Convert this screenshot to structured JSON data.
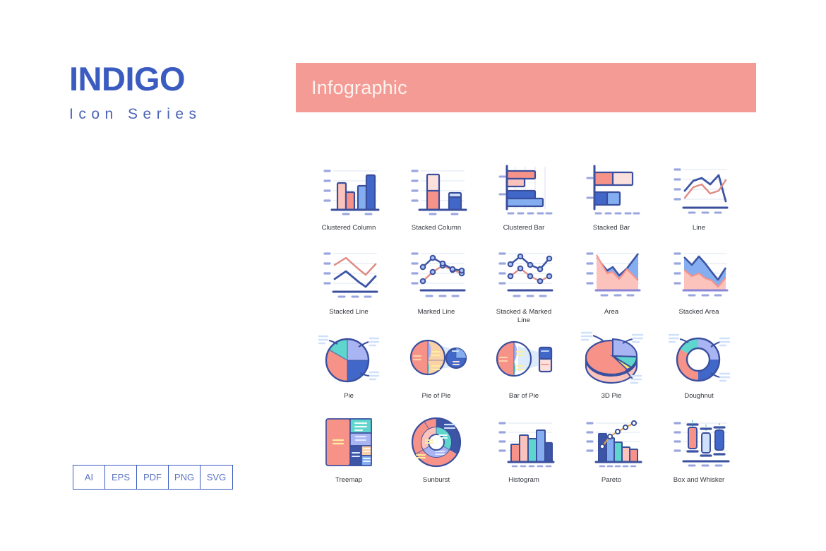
{
  "brand": {
    "title": "INDIGO",
    "subtitle": "Icon Series",
    "title_color": "#3a5bbf"
  },
  "formats": [
    {
      "label": "AI"
    },
    {
      "label": "EPS"
    },
    {
      "label": "PDF"
    },
    {
      "label": "PNG"
    },
    {
      "label": "SVG"
    }
  ],
  "banner": {
    "title": "Infographic",
    "background": "#f49b96",
    "text_color": "#fdf3ef"
  },
  "palette": {
    "navy": "#3d55a5",
    "blue": "#4168c8",
    "light_blue": "#84aef0",
    "lavender": "#a9b4f2",
    "salmon": "#f79289",
    "light_salmon": "#fbc3bc",
    "teal": "#5fd6cd",
    "peach": "#fbd1a8",
    "outline": "#3a4f9e",
    "grid": "#e8edf7",
    "tick": "#9aa6e0"
  },
  "grid": {
    "columns": 5,
    "icons": [
      {
        "name": "clustered-column",
        "label": "Clustered Column"
      },
      {
        "name": "stacked-column",
        "label": "Stacked Column"
      },
      {
        "name": "clustered-bar",
        "label": "Clustered Bar"
      },
      {
        "name": "stacked-bar",
        "label": "Stacked Bar"
      },
      {
        "name": "line",
        "label": "Line"
      },
      {
        "name": "stacked-line",
        "label": "Stacked Line"
      },
      {
        "name": "marked-line",
        "label": "Marked Line"
      },
      {
        "name": "stacked-marked-line",
        "label": "Stacked & Marked Line"
      },
      {
        "name": "area",
        "label": "Area"
      },
      {
        "name": "stacked-area",
        "label": "Stacked Area"
      },
      {
        "name": "pie",
        "label": "Pie"
      },
      {
        "name": "pie-of-pie",
        "label": "Pie of Pie"
      },
      {
        "name": "bar-of-pie",
        "label": "Bar of Pie"
      },
      {
        "name": "3d-pie",
        "label": "3D Pie"
      },
      {
        "name": "doughnut",
        "label": "Doughnut"
      },
      {
        "name": "treemap",
        "label": "Treemap"
      },
      {
        "name": "sunburst",
        "label": "Sunburst"
      },
      {
        "name": "histogram",
        "label": "Histogram"
      },
      {
        "name": "pareto",
        "label": "Pareto"
      },
      {
        "name": "box-and-whisker",
        "label": "Box and Whisker"
      }
    ]
  }
}
